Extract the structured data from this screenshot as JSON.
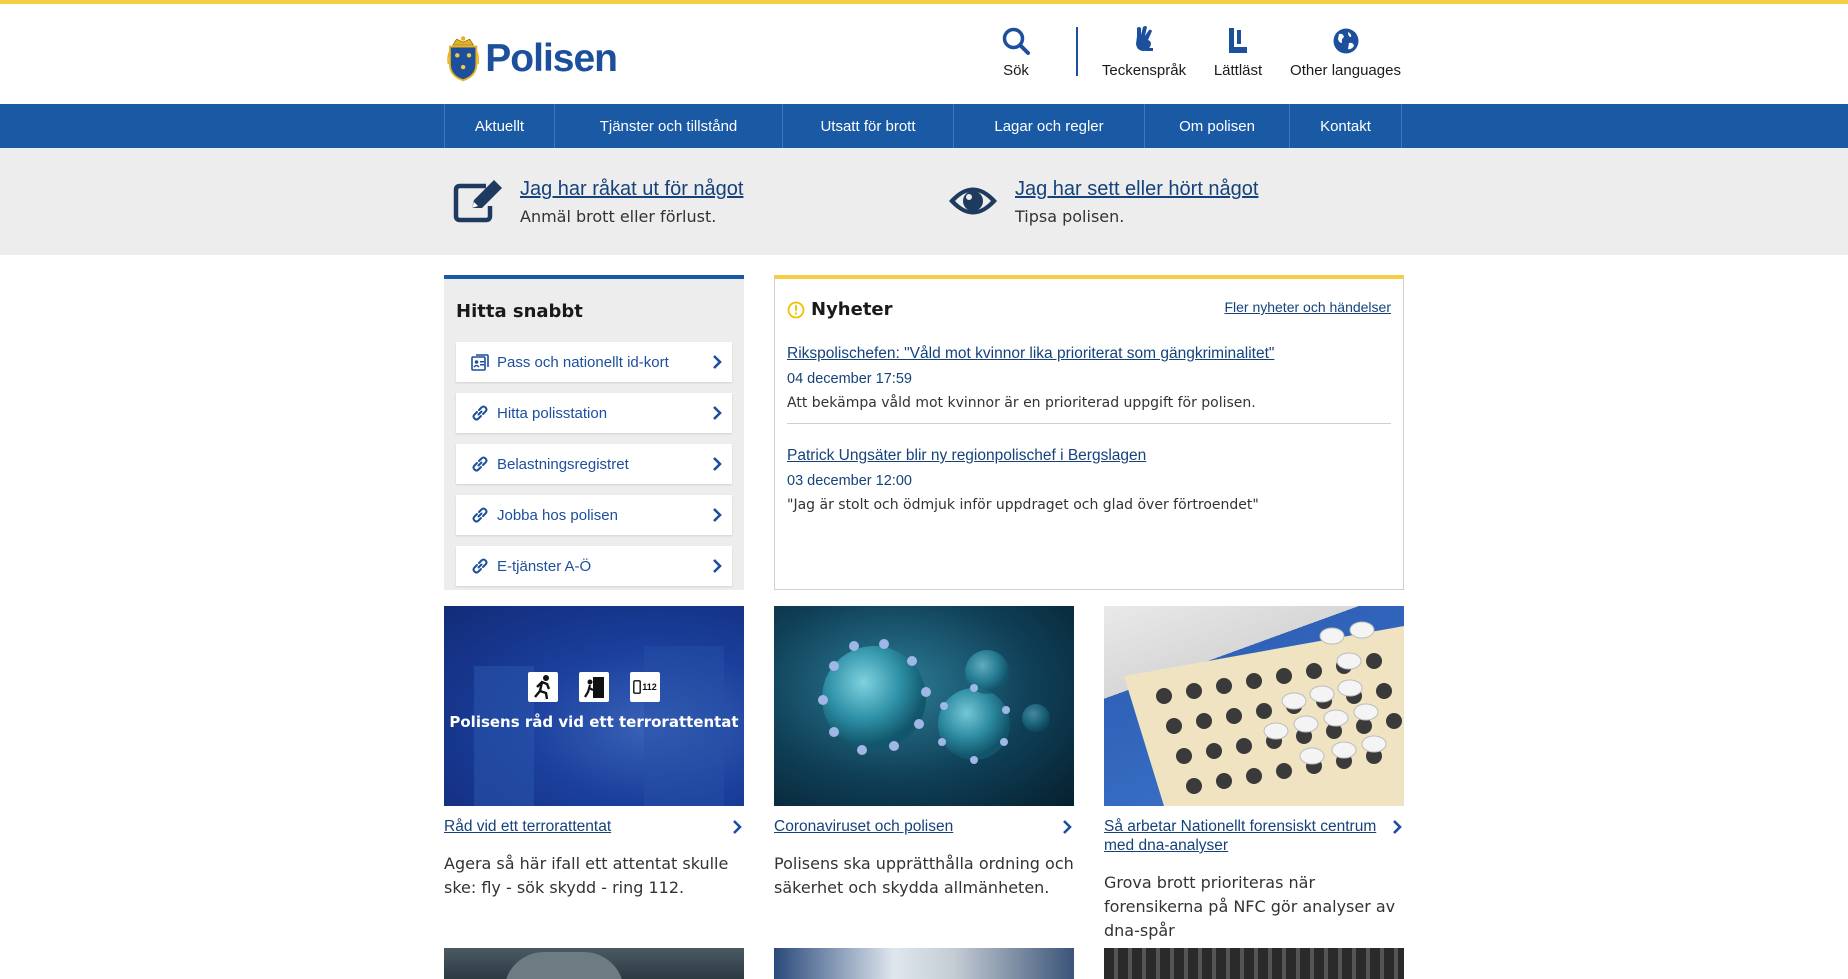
{
  "brand": {
    "name": "Polisen",
    "primary": "#1a5aa5",
    "accent": "#f7cd44",
    "link": "#15427a"
  },
  "header": {
    "search_label": "Sök",
    "sign_language_label": "Teckenspråk",
    "easy_read_label": "Lättläst",
    "other_languages_label": "Other languages"
  },
  "nav": {
    "items": [
      "Aktuellt",
      "Tjänster och tillstånd",
      "Utsatt för brott",
      "Lagar och regler",
      "Om polisen",
      "Kontakt"
    ]
  },
  "report": {
    "crime": {
      "title": "Jag har råkat ut för något",
      "subtitle": "Anmäl brott eller förlust.",
      "icon": "edit-icon"
    },
    "tip": {
      "title": "Jag har sett eller hört något",
      "subtitle": "Tipsa polisen.",
      "icon": "eye-icon"
    }
  },
  "quick": {
    "title": "Hitta snabbt",
    "items": [
      {
        "label": "Pass och nationellt id-kort",
        "icon": "id-card-icon"
      },
      {
        "label": "Hitta polisstation",
        "icon": "link-icon"
      },
      {
        "label": "Belastningsregistret",
        "icon": "link-icon"
      },
      {
        "label": "Jobba hos polisen",
        "icon": "link-icon"
      },
      {
        "label": "E-tjänster A-Ö",
        "icon": "link-icon"
      }
    ]
  },
  "news": {
    "title": "Nyheter",
    "more_link": "Fler nyheter och händelser",
    "items": [
      {
        "title": "Rikspolischefen: \"Våld mot kvinnor lika prioriterat som gängkriminalitet\"",
        "date": "04 december 17:59",
        "summary": "Att bekämpa våld mot kvinnor är en prioriterad uppgift för polisen."
      },
      {
        "title": "Patrick Ungsäter blir ny regionpolischef i Bergslagen",
        "date": "03 december 12:00",
        "summary": "\"Jag är stolt och ödmjuk inför uppdraget och glad över förtroendet\""
      }
    ]
  },
  "cards": [
    {
      "title": "Råd vid ett terrorattentat",
      "text": "Agera så här ifall ett attentat skulle ske: fly - sök skydd - ring 112.",
      "image_caption": "Polisens råd vid ett terrorattentat",
      "image_badge": "112"
    },
    {
      "title": "Coronaviruset och polisen",
      "text": "Polisens ska upprätthålla ordning och säkerhet och skydda allmänheten."
    },
    {
      "title": "Så arbetar Nationellt forensiskt centrum med dna-analyser",
      "text": "Grova brott prioriteras när forensikerna på NFC gör analyser av dna-spår"
    }
  ]
}
